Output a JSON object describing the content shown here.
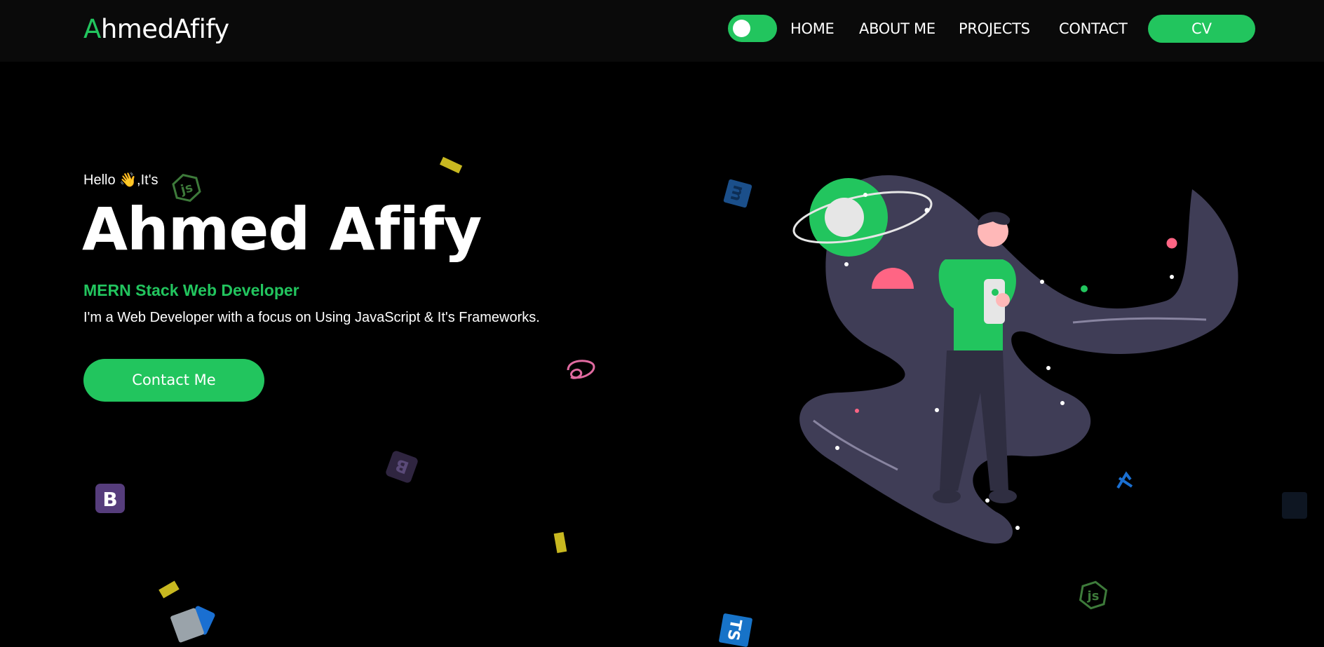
{
  "brand": {
    "logo_first": "A",
    "logo_rest": "hmedAfify",
    "accent_color": "#22c55e"
  },
  "nav": {
    "theme_toggle": "theme-toggle",
    "links": [
      "HOME",
      "ABOUT ME",
      "PROJECTS",
      "CONTACT"
    ],
    "cv_label": "CV"
  },
  "hero": {
    "greeting": "Hello 👋,It's",
    "name": "Ahmed Afify",
    "role": "MERN Stack Web Developer",
    "description": "I'm a Web Developer with a focus on Using JavaScript & It's Frameworks.",
    "cta_label": "Contact Me"
  },
  "floating_icons": {
    "bootstrap_letter": "B",
    "typescript_letters": "TS"
  },
  "colors": {
    "background": "#000000",
    "navbar": "#0a0a0a",
    "accent": "#22c55e",
    "galaxy": "#3f3d56",
    "pink": "#ff6584"
  }
}
